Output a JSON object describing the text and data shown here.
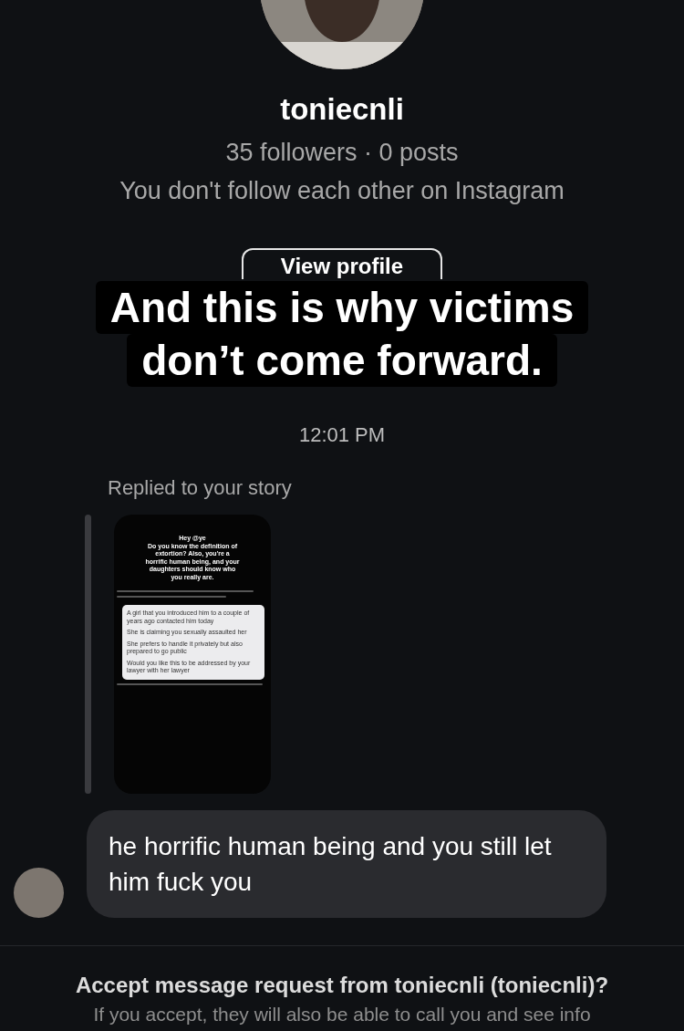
{
  "profile": {
    "username": "toniecnli",
    "stats": "35 followers · 0 posts",
    "relation": "You don't follow each other on Instagram",
    "button": "View profile"
  },
  "caption": [
    "And this is why victims",
    "don’t come forward."
  ],
  "timestamp": "12:01 PM",
  "story_reply": {
    "label": "Replied to your story",
    "story_heading": "Hey @ye",
    "story_text": "Do you know the definition of extortion? Also, you're a horrific human being, and your daughters should know who you really are.",
    "embedded_message": [
      "A girl that you introduced him to a couple of years ago contacted him today",
      "She is claiming you sexually assaulted her",
      "She prefers to handle it privately but also prepared to go public",
      "Would you like this to be addressed by your lawyer with her lawyer"
    ]
  },
  "message": {
    "text": "he horrific human being and you still let him fuck you"
  },
  "request": {
    "title": "Accept message request from toniecnli (toniecnli)?",
    "body": "If you accept, they will also be able to call you and see info"
  }
}
